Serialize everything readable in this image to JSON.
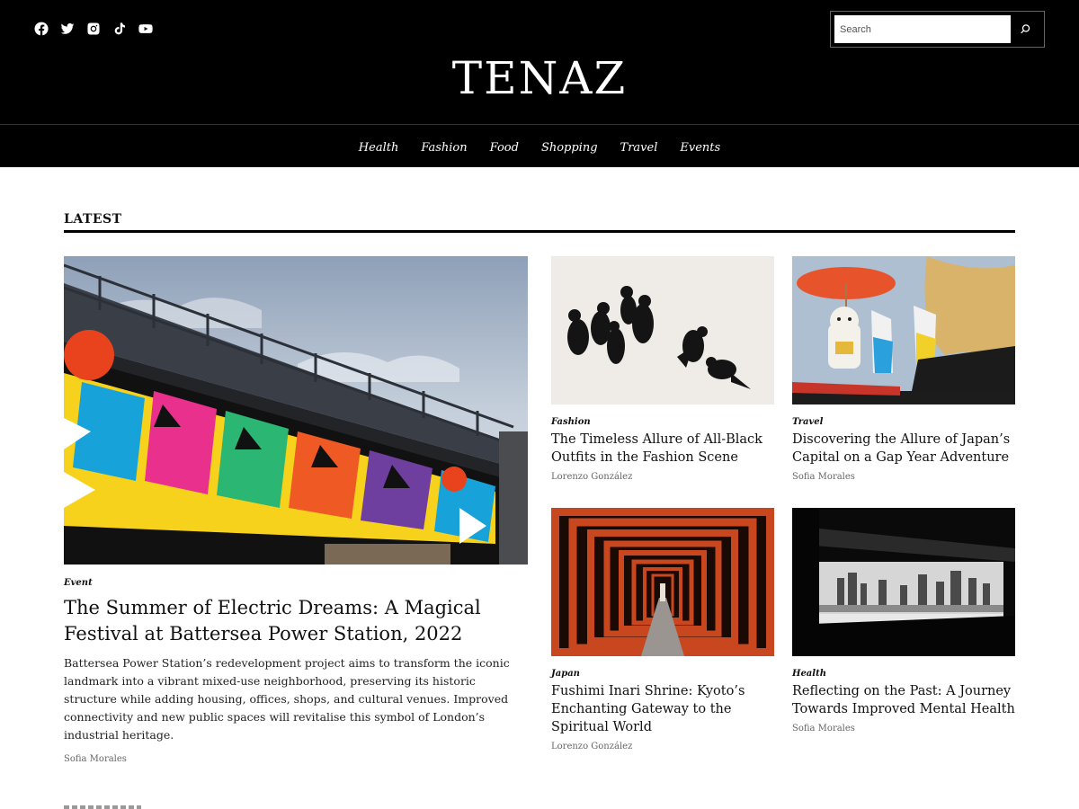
{
  "header": {
    "site_title": "TENAZ",
    "search": {
      "placeholder": "Search"
    },
    "socials": [
      "facebook-icon",
      "twitter-icon",
      "instagram-icon",
      "tiktok-icon",
      "youtube-icon"
    ]
  },
  "nav": {
    "items": [
      "Health",
      "Fashion",
      "Food",
      "Shopping",
      "Travel",
      "Events"
    ]
  },
  "section": {
    "heading": "LATEST"
  },
  "featured": {
    "category": "Event",
    "title": "The Summer of Electric Dreams: A Magical Festival at Battersea Power Station, 2022",
    "excerpt": "Battersea Power Station’s redevelopment project aims to transform the iconic landmark into a vibrant mixed-use neighborhood, preserving its historic structure while adding housing, offices, shops, and cultural venues. Improved connectivity and new public spaces will revitalise this symbol of London’s industrial heritage.",
    "author": "Sofia Morales"
  },
  "posts": [
    {
      "category": "Fashion",
      "title": "The Timeless Allure of All-Black Outfits in the Fashion Scene",
      "author": "Lorenzo González"
    },
    {
      "category": "Travel",
      "title": "Discovering the Allure of Japan’s Capital on a Gap Year Adventure",
      "author": "Sofia Morales"
    },
    {
      "category": "Japan",
      "title": "Fushimi Inari Shrine: Kyoto’s Enchanting Gateway to the Spiritual World",
      "author": "Lorenzo González"
    },
    {
      "category": "Health",
      "title": "Reflecting on the Past: A Journey Towards Improved Mental Health",
      "author": "Sofia Morales"
    }
  ],
  "colors": {
    "header_bg": "#000000",
    "text": "#111111",
    "meta": "#666666",
    "torii": "#c8471f"
  }
}
